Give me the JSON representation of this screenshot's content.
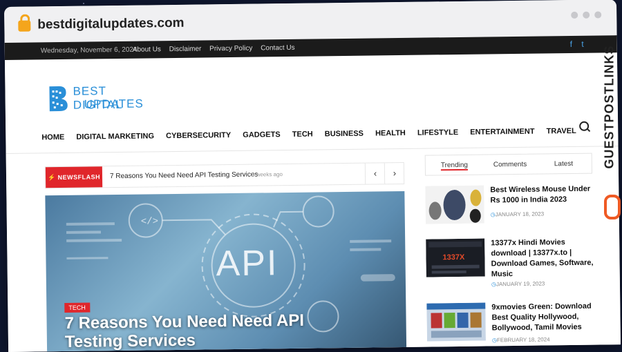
{
  "browser": {
    "url": "bestdigitalupdates.com"
  },
  "topbar": {
    "date": "Wednesday, November 6, 2024",
    "links": [
      "About Us",
      "Disclaimer",
      "Privacy Policy",
      "Contact Us"
    ],
    "social": [
      "f",
      "t"
    ]
  },
  "logo": {
    "line1": "BEST DIGITAL",
    "line2": "UPDATES",
    "color": "#2a8fd8"
  },
  "nav": [
    "HOME",
    "DIGITAL MARKETING",
    "CYBERSECURITY",
    "GADGETS",
    "TECH",
    "BUSINESS",
    "HEALTH",
    "LIFESTYLE",
    "ENTERTAINMENT",
    "TRAVEL"
  ],
  "newsflash": {
    "label": "NEWSFLASH",
    "headline": "7 Reasons You Need Need API Testing Services",
    "ago": "3 weeks ago",
    "prev": "‹",
    "next": "›"
  },
  "hero": {
    "category": "TECH",
    "title": "7 Reasons You Need Need API Testing Services",
    "image_text": "API"
  },
  "sidebar": {
    "tabs": [
      "Trending",
      "Comments",
      "Latest"
    ],
    "posts": [
      {
        "title": "Best Wireless Mouse Under Rs 1000 in India 2023",
        "date": "JANUARY 18, 2023"
      },
      {
        "title": "13377x Hindi Movies download | 13377x.to | Download Games, Software, Music",
        "date": "JANUARY 19, 2023"
      },
      {
        "title": "9xmovies Green: Download Best Quality Hollywood, Bollywood, Tamil Movies",
        "date": "FEBRUARY 18, 2024"
      }
    ]
  },
  "watermark": {
    "text": "GUESTPOSTLINKS"
  },
  "colors": {
    "accent": "#e0262b",
    "brand": "#2a8fd8",
    "watermark": "#ef5a24"
  }
}
